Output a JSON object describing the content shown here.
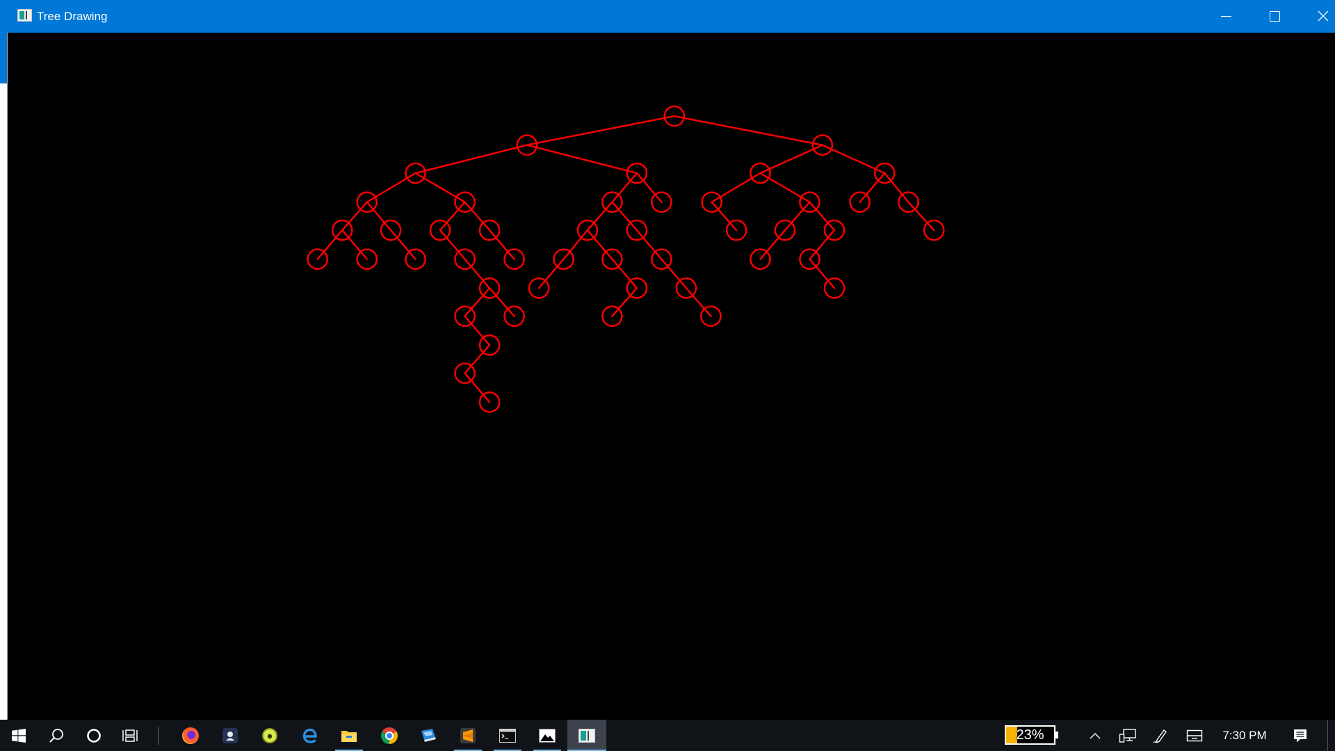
{
  "window": {
    "title": "Tree Drawing",
    "app_icon": "tree-drawing-app-icon",
    "controls": [
      "minimize-icon",
      "maximize-icon",
      "close-icon"
    ]
  },
  "colors": {
    "title_bar": "#0078d7",
    "canvas_background": "#000000",
    "tree_stroke": "#ff0000",
    "taskbar_background": "#101419",
    "active_app_background": "#3c434d",
    "running_indicator": "#76b9ed",
    "battery_fill": "#f5b400"
  },
  "taskbar": {
    "system_buttons": [
      {
        "icon": "windows-start-icon"
      },
      {
        "icon": "search-icon"
      },
      {
        "icon": "cortana-icon"
      },
      {
        "icon": "task-view-icon"
      }
    ],
    "apps": [
      {
        "icon": "firefox-icon",
        "running": false,
        "active": false
      },
      {
        "icon": "dark-square-app-icon",
        "running": false,
        "active": false
      },
      {
        "icon": "green-circle-app-icon",
        "running": false,
        "active": false
      },
      {
        "icon": "edge-icon",
        "running": false,
        "active": false
      },
      {
        "icon": "file-explorer-icon",
        "running": true,
        "active": false
      },
      {
        "icon": "chrome-icon",
        "running": false,
        "active": false
      },
      {
        "icon": "remote-desktop-icon",
        "running": false,
        "active": false
      },
      {
        "icon": "sublime-text-icon",
        "running": true,
        "active": false
      },
      {
        "icon": "command-prompt-icon",
        "running": true,
        "active": false
      },
      {
        "icon": "photos-icon",
        "running": true,
        "active": false
      },
      {
        "icon": "tree-drawing-app-icon",
        "running": true,
        "active": true
      }
    ],
    "tray": {
      "battery": {
        "label": "23%",
        "level_percent": 23
      },
      "icons": [
        "chevron-up-icon",
        "network-icon",
        "windows-ink-icon",
        "touch-keyboard-icon",
        "action-center-icon"
      ],
      "clock": "7:30 PM"
    }
  }
}
